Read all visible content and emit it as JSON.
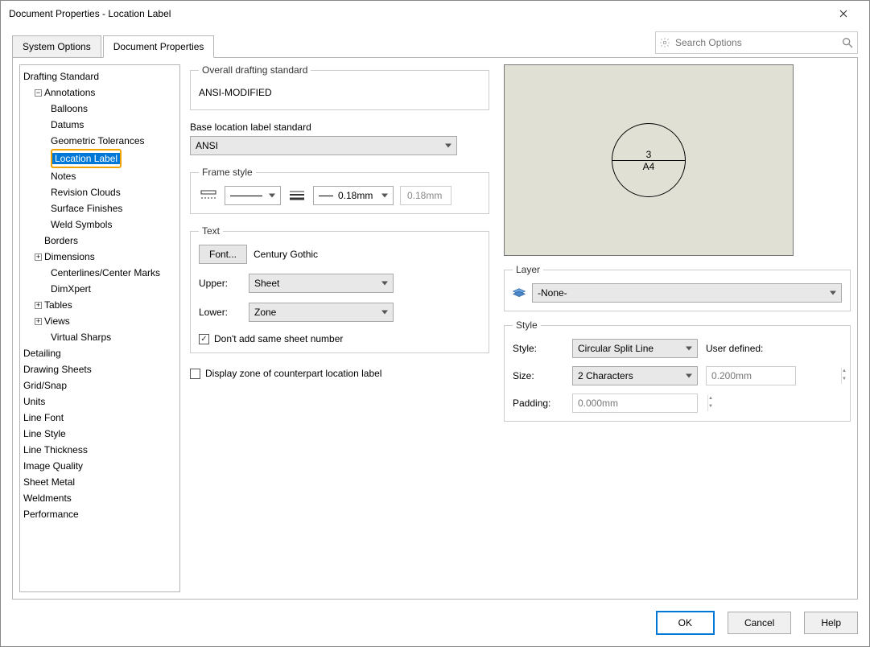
{
  "window": {
    "title": "Document Properties - Location Label"
  },
  "tabs": {
    "system": "System Options",
    "document": "Document Properties"
  },
  "search": {
    "placeholder": "Search Options"
  },
  "tree": {
    "drafting": "Drafting Standard",
    "annotations": "Annotations",
    "balloons": "Balloons",
    "datums": "Datums",
    "geotol": "Geometric Tolerances",
    "locationLabel": "Location Label",
    "notes": "Notes",
    "revClouds": "Revision Clouds",
    "surfFinish": "Surface Finishes",
    "weldSymbols": "Weld Symbols",
    "borders": "Borders",
    "dimensions": "Dimensions",
    "centerlines": "Centerlines/Center Marks",
    "dimxpert": "DimXpert",
    "tables": "Tables",
    "views": "Views",
    "virtualSharps": "Virtual Sharps",
    "detailing": "Detailing",
    "drawingSheets": "Drawing Sheets",
    "gridSnap": "Grid/Snap",
    "units": "Units",
    "lineFont": "Line Font",
    "lineStyle": "Line Style",
    "lineThickness": "Line Thickness",
    "imageQuality": "Image Quality",
    "sheetMetal": "Sheet Metal",
    "weldments": "Weldments",
    "performance": "Performance"
  },
  "overall": {
    "legend": "Overall drafting standard",
    "value": "ANSI-MODIFIED"
  },
  "baseStd": {
    "label": "Base location label standard",
    "value": "ANSI"
  },
  "frameStyle": {
    "legend": "Frame style",
    "thickness": "0.18mm",
    "readonly": "0.18mm"
  },
  "text": {
    "legend": "Text",
    "fontBtn": "Font...",
    "fontName": "Century Gothic",
    "upperLabel": "Upper:",
    "upperValue": "Sheet",
    "lowerLabel": "Lower:",
    "lowerValue": "Zone",
    "dontAdd": "Don't add same sheet number"
  },
  "displayZone": "Display zone of counterpart location label",
  "preview": {
    "top": "3",
    "bottom": "A4"
  },
  "layer": {
    "legend": "Layer",
    "value": "-None-"
  },
  "style": {
    "legend": "Style",
    "styleLabel": "Style:",
    "styleValue": "Circular Split Line",
    "sizeLabel": "Size:",
    "sizeValue": "2 Characters",
    "paddingLabel": "Padding:",
    "paddingValue": "0.000mm",
    "userDefinedLabel": "User defined:",
    "userDefinedValue": "0.200mm"
  },
  "footer": {
    "ok": "OK",
    "cancel": "Cancel",
    "help": "Help"
  }
}
